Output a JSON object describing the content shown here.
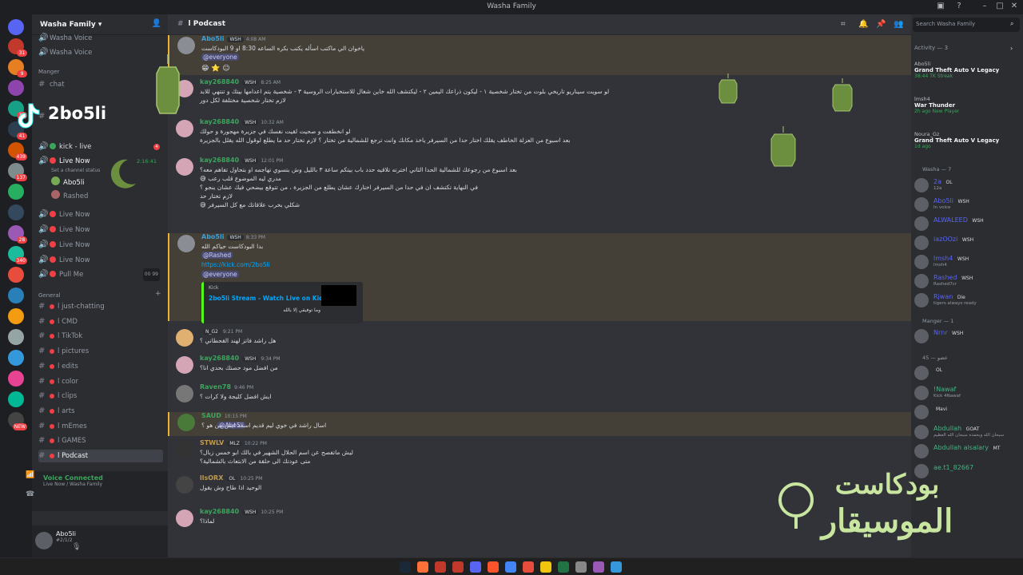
{
  "window": {
    "title": "Washa Family"
  },
  "guild": {
    "name": "Washa Family"
  },
  "server_badges": [
    "31",
    "9",
    "",
    "35",
    "41",
    "439",
    "137",
    "",
    "",
    "28",
    "340",
    "",
    "",
    "",
    "",
    "",
    "",
    "",
    "NEW"
  ],
  "channels": {
    "top": [
      {
        "label": "Washa Voice"
      },
      {
        "label": "Washa Voice"
      },
      {
        "label": "Manger"
      },
      {
        "label": "chat"
      },
      {
        "label": "ct"
      }
    ],
    "voice": [
      {
        "label": "kick - live",
        "badge": "4"
      },
      {
        "label": "Live Now",
        "time": "2:16:41",
        "status": "Set a channel status"
      },
      {
        "label": "Abo5li"
      },
      {
        "label": "Rashed"
      },
      {
        "label": "Live Now"
      },
      {
        "label": "Live Now"
      },
      {
        "label": "Live Now"
      },
      {
        "label": "Live Now"
      },
      {
        "label": "Pull Me",
        "count_a": "00",
        "count_b": "99"
      }
    ],
    "general_category": "General",
    "text": [
      {
        "label": "l just-chatting"
      },
      {
        "label": "l CMD"
      },
      {
        "label": "l TikTok"
      },
      {
        "label": "l pictures"
      },
      {
        "label": "l edits"
      },
      {
        "label": "l color"
      },
      {
        "label": "l clips"
      },
      {
        "label": "l arts"
      },
      {
        "label": "l mEmes"
      },
      {
        "label": "l GAMES"
      },
      {
        "label": "l Podcast"
      }
    ]
  },
  "voice_status": {
    "title": "Voice Connected",
    "subtitle": "Live Now / Washa Family"
  },
  "user_panel": {
    "name": "Abo5li",
    "status": "#2/1/2"
  },
  "channel_header": {
    "name": "l Podcast"
  },
  "messages": [
    {
      "author": "Abo5li",
      "tag": "WSH",
      "time": "4:08 AM",
      "lines": [
        "ياخوان الي ماكتب اسأله يكتب بكره الساعه 8:30 او 9 البودكاست"
      ],
      "mention": "@everyone",
      "reactions": "😁 ⭐ ☺"
    },
    {
      "author": "kay268840",
      "tag": "WSH",
      "time": "8:25 AM",
      "lines": [
        "لو سويت سيناريو تاريخي بلوت من تختار شخصية ١ - ليكون ذراعك اليمين ٢ - ليكتشف الله خاين شغال للاستخبارات الروسية ٣ - شخصية يتم اعدامها بيتك و تنتهي للابد",
        "لازم تختار شخصية مختلفة لكل دور"
      ]
    },
    {
      "author": "kay268840",
      "tag": "WSH",
      "time": "10:32 AM",
      "lines": [
        "لو انخطفت و صحيت لقيت نفسك في جزيرة مهجورة و حولك",
        "بعد اسبوع من العزلة الخاطف يقلك اختار حدا من السيرفر ياخذ مكانك وانت ترجع للشمالية من تختار ؟ لازم تختار حد ما يطلع لوقول الله يقلل بالجزيرة"
      ]
    },
    {
      "author": "kay268840",
      "tag": "WSH",
      "time": "12:01 PM",
      "lines": [
        "بعد اسبوع من رجوعك للشمالية الحدا الثاني اخترته تلاقيه حدد باب بيتكم ساعة ٣ بالليل وش بتسوي تهاجمه او بتحاول تفاهم معه؟",
        "مدري ليه الموضوع قلب رعب 😅",
        "في النهاية تكتشف ان في حدا من السيرفر اختارك عشان يطلع من الجزيرة ، من تتوقع بيضحي فيك عشان ينجو ؟",
        "لازم تختار حد",
        "شكلي بخرب علاقاتك مع كل السيرفر 😅"
      ]
    },
    {
      "author": "Abo5li",
      "tag": "WSH",
      "time": "8:33 PM",
      "lines": [
        "بدا البودكاست حياكم الله"
      ],
      "mention_inline": "@Rashed",
      "link": "https://kick.com/2bo5li",
      "mention": "@everyone",
      "embed": {
        "provider": "Kick",
        "title": "2bo5li Stream - Watch Live on Kick",
        "desc": "وما توفيقي إلا بالله"
      }
    },
    {
      "author": "",
      "tag": "N_G2",
      "time": "9:21 PM",
      "lines": [
        "هل راشد فاتز لهند القحطاني ؟"
      ]
    },
    {
      "author": "kay268840",
      "tag": "WSH",
      "time": "9:34 PM",
      "lines": [
        "من افضل مود حصتك بحدي انا؟"
      ]
    },
    {
      "author": "Raven78",
      "tag": "",
      "time": "9:46 PM",
      "lines": [
        "ايش افضل كليجة ولا كرات ؟"
      ]
    },
    {
      "author": "SAUD",
      "tag": "",
      "time": "10:15 PM",
      "lines": [
        "اسال راشد في خوي ليم قديم اسمه ايش من هو ؟"
      ],
      "mention": "@Abo5li"
    },
    {
      "author": "STWLV",
      "tag": "MLZ",
      "time": "10:22 PM",
      "lines": [
        "ليش ماتفصح عن اسم الحلال الشهير في بالك ابو خمس زبال؟",
        "متى عودتك الى حلقة من الابتعاث بالشمالية؟"
      ]
    },
    {
      "author": "llsORX",
      "tag": "OL",
      "time": "10:25 PM",
      "lines": [
        "الوحيد اذا طاح وش يقول"
      ]
    },
    {
      "author": "kay268840",
      "tag": "WSH",
      "time": "10:25 PM",
      "lines": [
        "لماذا؟"
      ]
    }
  ],
  "members": {
    "search_placeholder": "Search Washa Family",
    "activity_title": "Activity — 3",
    "activities": [
      {
        "user": "Abo5li",
        "game": "Grand Theft Auto V Legacy",
        "detail": "38:44  TK Streak"
      },
      {
        "user": "lmsh4",
        "game": "War Thunder",
        "detail": "2h ago  New Player"
      },
      {
        "user": "Noura_Gz",
        "game": "Grand Theft Auto V Legacy",
        "detail": "1d ago"
      }
    ],
    "washa_title": "Washa — 7",
    "washa": [
      {
        "name": "2a",
        "tag": "OL",
        "status": "12a",
        "color": "#5865f2"
      },
      {
        "name": "Abo5li",
        "tag": "WSH",
        "status": "In voice",
        "color": "#5865f2"
      },
      {
        "name": "ALWALEED",
        "tag": "WSH",
        "status": "",
        "color": "#5865f2"
      },
      {
        "name": "iazOOzi",
        "tag": "WSH",
        "status": "",
        "color": "#5865f2"
      },
      {
        "name": "lmsh4",
        "tag": "WSH",
        "status": "lmsh4",
        "color": "#5865f2"
      },
      {
        "name": "Rashed",
        "tag": "WSH",
        "status": "Rashed7cr",
        "color": "#5865f2"
      },
      {
        "name": "Rjwan",
        "tag": "Die",
        "status": "tigers always ready",
        "color": "#5865f2"
      }
    ],
    "manger_title": "Manger — 1",
    "manger": [
      {
        "name": "Nrnr",
        "tag": "WSH",
        "status": "",
        "color": "#5865f2"
      }
    ],
    "other_title": "عضو — 45",
    "others": [
      {
        "name": "",
        "tag": "OL",
        "status": "",
        "color": "#5865f2"
      },
      {
        "name": "!Nawaf",
        "tag": "",
        "status": "Kick 4Nawaf",
        "color": "#43b581"
      },
      {
        "name": "",
        "tag": "Mavi",
        "status": "",
        "color": "#5865f2"
      },
      {
        "name": "Abdullah",
        "tag": "GOAT",
        "status": "سبحان الله وبحمده سبحان الله العظيم",
        "color": "#43b581"
      },
      {
        "name": "Abdullah alsalary",
        "tag": "MT",
        "status": "",
        "color": "#43b581"
      },
      {
        "name": "ae.t1_82667",
        "tag": "",
        "status": "",
        "color": "#43b581"
      }
    ]
  },
  "overlay": {
    "tiktok_handle": "2bo5li",
    "brand_line1": "بودكاست",
    "brand_line2": "الموسيقار"
  },
  "colors": {
    "accent": "#5865f2",
    "mention_bg": "#f0b132",
    "kick": "#53fc18",
    "wsh_name": "#3aa0d8",
    "kay_name": "#3ba55c"
  }
}
